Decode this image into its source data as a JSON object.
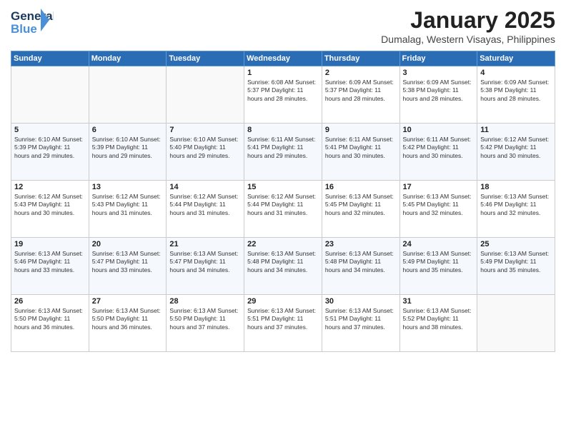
{
  "header": {
    "logo_line1": "General",
    "logo_line2": "Blue",
    "month": "January 2025",
    "location": "Dumalag, Western Visayas, Philippines"
  },
  "days_of_week": [
    "Sunday",
    "Monday",
    "Tuesday",
    "Wednesday",
    "Thursday",
    "Friday",
    "Saturday"
  ],
  "weeks": [
    [
      {
        "day": "",
        "info": ""
      },
      {
        "day": "",
        "info": ""
      },
      {
        "day": "",
        "info": ""
      },
      {
        "day": "1",
        "info": "Sunrise: 6:08 AM\nSunset: 5:37 PM\nDaylight: 11 hours\nand 28 minutes."
      },
      {
        "day": "2",
        "info": "Sunrise: 6:09 AM\nSunset: 5:37 PM\nDaylight: 11 hours\nand 28 minutes."
      },
      {
        "day": "3",
        "info": "Sunrise: 6:09 AM\nSunset: 5:38 PM\nDaylight: 11 hours\nand 28 minutes."
      },
      {
        "day": "4",
        "info": "Sunrise: 6:09 AM\nSunset: 5:38 PM\nDaylight: 11 hours\nand 28 minutes."
      }
    ],
    [
      {
        "day": "5",
        "info": "Sunrise: 6:10 AM\nSunset: 5:39 PM\nDaylight: 11 hours\nand 29 minutes."
      },
      {
        "day": "6",
        "info": "Sunrise: 6:10 AM\nSunset: 5:39 PM\nDaylight: 11 hours\nand 29 minutes."
      },
      {
        "day": "7",
        "info": "Sunrise: 6:10 AM\nSunset: 5:40 PM\nDaylight: 11 hours\nand 29 minutes."
      },
      {
        "day": "8",
        "info": "Sunrise: 6:11 AM\nSunset: 5:41 PM\nDaylight: 11 hours\nand 29 minutes."
      },
      {
        "day": "9",
        "info": "Sunrise: 6:11 AM\nSunset: 5:41 PM\nDaylight: 11 hours\nand 30 minutes."
      },
      {
        "day": "10",
        "info": "Sunrise: 6:11 AM\nSunset: 5:42 PM\nDaylight: 11 hours\nand 30 minutes."
      },
      {
        "day": "11",
        "info": "Sunrise: 6:12 AM\nSunset: 5:42 PM\nDaylight: 11 hours\nand 30 minutes."
      }
    ],
    [
      {
        "day": "12",
        "info": "Sunrise: 6:12 AM\nSunset: 5:43 PM\nDaylight: 11 hours\nand 30 minutes."
      },
      {
        "day": "13",
        "info": "Sunrise: 6:12 AM\nSunset: 5:43 PM\nDaylight: 11 hours\nand 31 minutes."
      },
      {
        "day": "14",
        "info": "Sunrise: 6:12 AM\nSunset: 5:44 PM\nDaylight: 11 hours\nand 31 minutes."
      },
      {
        "day": "15",
        "info": "Sunrise: 6:12 AM\nSunset: 5:44 PM\nDaylight: 11 hours\nand 31 minutes."
      },
      {
        "day": "16",
        "info": "Sunrise: 6:13 AM\nSunset: 5:45 PM\nDaylight: 11 hours\nand 32 minutes."
      },
      {
        "day": "17",
        "info": "Sunrise: 6:13 AM\nSunset: 5:45 PM\nDaylight: 11 hours\nand 32 minutes."
      },
      {
        "day": "18",
        "info": "Sunrise: 6:13 AM\nSunset: 5:46 PM\nDaylight: 11 hours\nand 32 minutes."
      }
    ],
    [
      {
        "day": "19",
        "info": "Sunrise: 6:13 AM\nSunset: 5:46 PM\nDaylight: 11 hours\nand 33 minutes."
      },
      {
        "day": "20",
        "info": "Sunrise: 6:13 AM\nSunset: 5:47 PM\nDaylight: 11 hours\nand 33 minutes."
      },
      {
        "day": "21",
        "info": "Sunrise: 6:13 AM\nSunset: 5:47 PM\nDaylight: 11 hours\nand 34 minutes."
      },
      {
        "day": "22",
        "info": "Sunrise: 6:13 AM\nSunset: 5:48 PM\nDaylight: 11 hours\nand 34 minutes."
      },
      {
        "day": "23",
        "info": "Sunrise: 6:13 AM\nSunset: 5:48 PM\nDaylight: 11 hours\nand 34 minutes."
      },
      {
        "day": "24",
        "info": "Sunrise: 6:13 AM\nSunset: 5:49 PM\nDaylight: 11 hours\nand 35 minutes."
      },
      {
        "day": "25",
        "info": "Sunrise: 6:13 AM\nSunset: 5:49 PM\nDaylight: 11 hours\nand 35 minutes."
      }
    ],
    [
      {
        "day": "26",
        "info": "Sunrise: 6:13 AM\nSunset: 5:50 PM\nDaylight: 11 hours\nand 36 minutes."
      },
      {
        "day": "27",
        "info": "Sunrise: 6:13 AM\nSunset: 5:50 PM\nDaylight: 11 hours\nand 36 minutes."
      },
      {
        "day": "28",
        "info": "Sunrise: 6:13 AM\nSunset: 5:50 PM\nDaylight: 11 hours\nand 37 minutes."
      },
      {
        "day": "29",
        "info": "Sunrise: 6:13 AM\nSunset: 5:51 PM\nDaylight: 11 hours\nand 37 minutes."
      },
      {
        "day": "30",
        "info": "Sunrise: 6:13 AM\nSunset: 5:51 PM\nDaylight: 11 hours\nand 37 minutes."
      },
      {
        "day": "31",
        "info": "Sunrise: 6:13 AM\nSunset: 5:52 PM\nDaylight: 11 hours\nand 38 minutes."
      },
      {
        "day": "",
        "info": ""
      }
    ]
  ]
}
